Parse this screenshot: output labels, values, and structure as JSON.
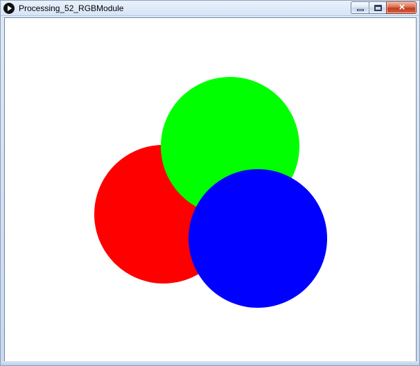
{
  "window": {
    "title": "Processing_52_RGBModule",
    "controls": {
      "minimize": "minimize",
      "maximize": "maximize",
      "close": "close"
    }
  },
  "sketch": {
    "background_color": "#ffffff",
    "circles": [
      {
        "name": "red-circle",
        "color": "#ff0000"
      },
      {
        "name": "green-circle",
        "color": "#00ff00"
      },
      {
        "name": "blue-circle",
        "color": "#0000ff"
      }
    ]
  }
}
